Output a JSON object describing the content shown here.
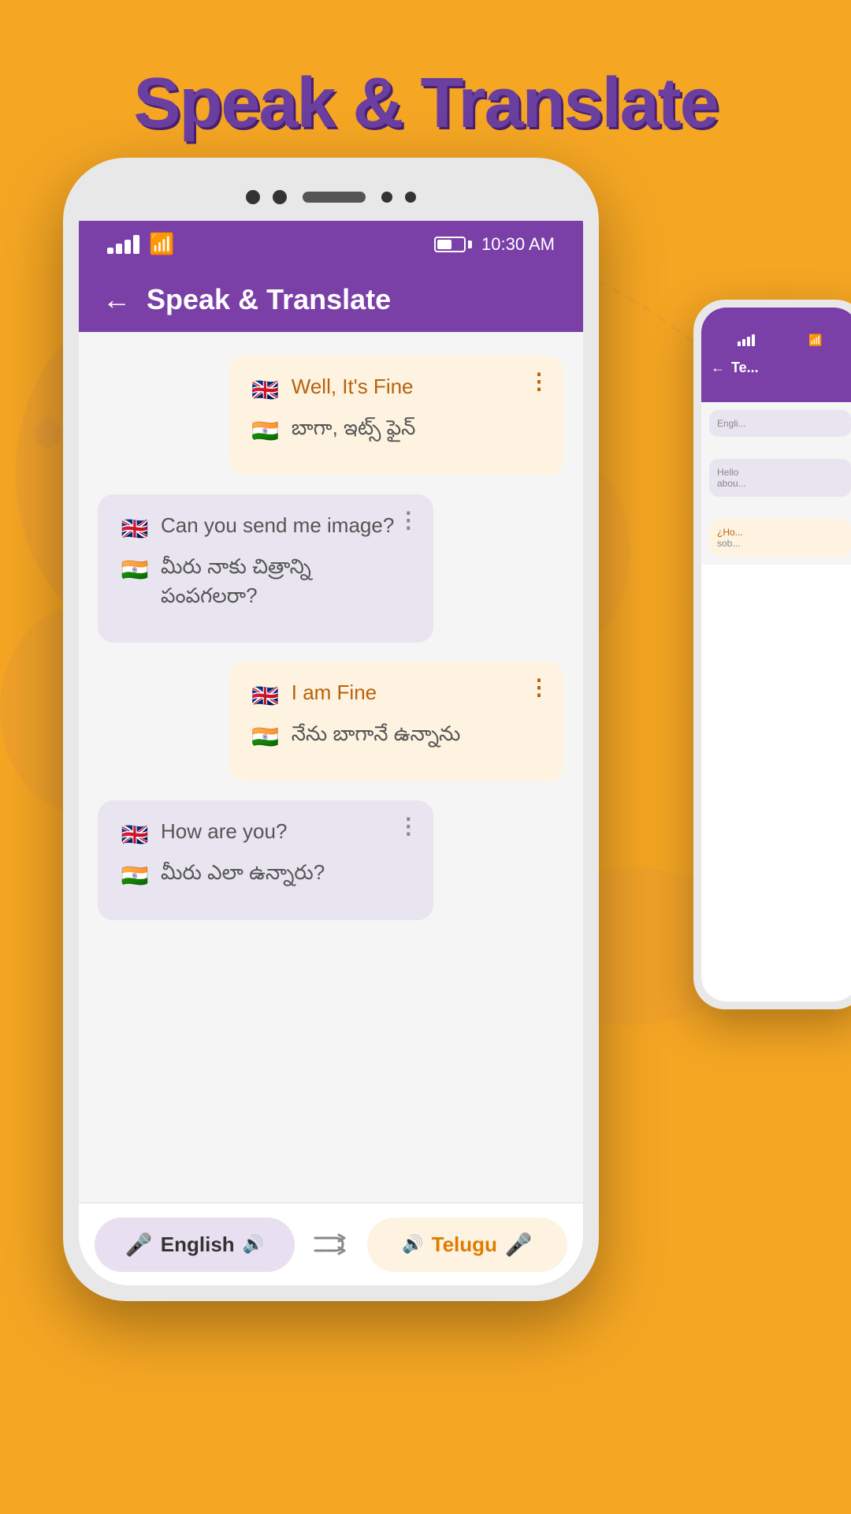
{
  "app": {
    "main_title": "Speak & Translate",
    "background_color": "#F5A623"
  },
  "status_bar": {
    "time": "10:30 AM"
  },
  "app_bar": {
    "title": "Speak & Translate",
    "back_label": "←"
  },
  "messages": [
    {
      "id": "msg1",
      "side": "right",
      "en_text": "Well, It's Fine",
      "te_text": "బాగా, ఇట్స్ ఫైన్"
    },
    {
      "id": "msg2",
      "side": "left",
      "en_text": "Can you send me image?",
      "te_text": "మీరు నాకు చిత్రాన్ని పంపగలరా?"
    },
    {
      "id": "msg3",
      "side": "right",
      "en_text": "I am Fine",
      "te_text": "నేను బాగానే ఉన్నాను"
    },
    {
      "id": "msg4",
      "side": "left",
      "en_text": "How are you?",
      "te_text": "మీరు ఎలా ఉన్నారు?"
    }
  ],
  "bottom_bar": {
    "lang1": "English",
    "lang2": "Telugu",
    "mic_icon": "🎤",
    "speaker_icon": "🔊",
    "shuffle_icon": "⇌"
  },
  "phone2": {
    "title": "Te...",
    "bubble1_text": "Engli...",
    "bubble2_line1": "Hello",
    "bubble2_line2": "abou...",
    "bubble3_line1": "¿Ho...",
    "bubble3_line2": "sob..."
  }
}
